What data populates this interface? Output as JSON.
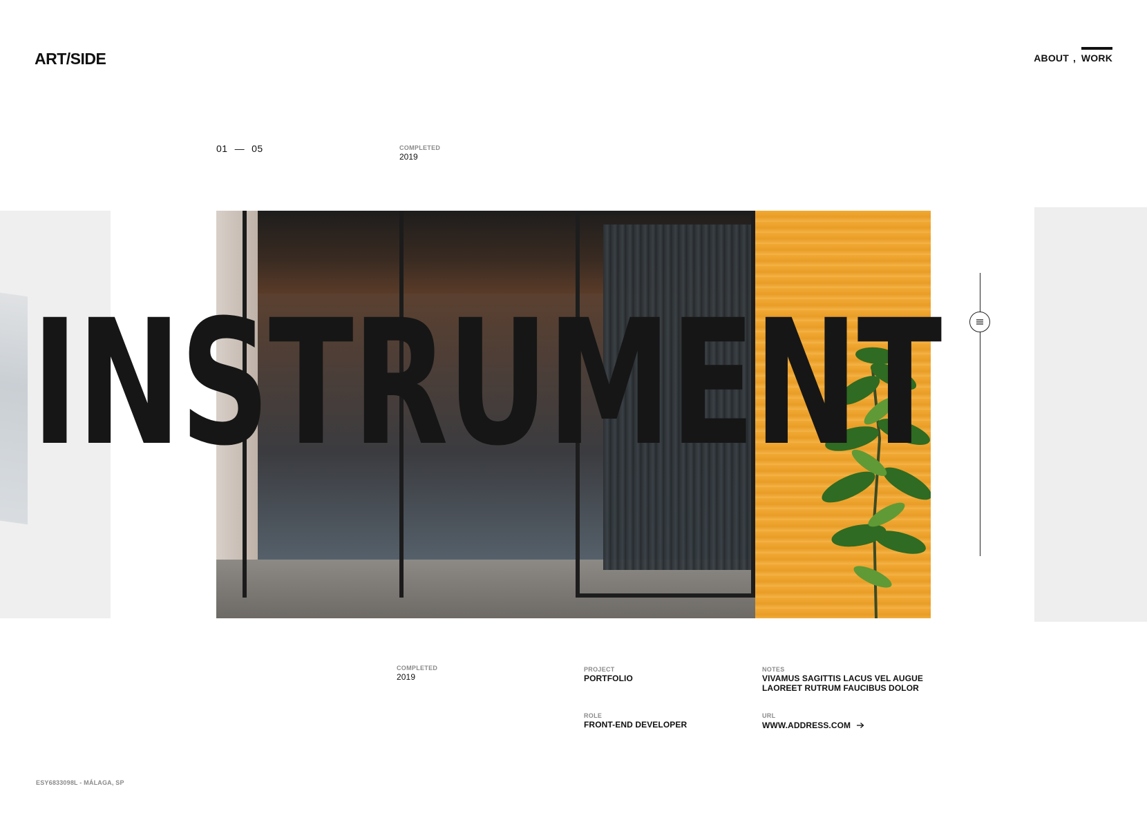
{
  "header": {
    "logo": "ART/SIDE",
    "nav": [
      {
        "label": "ABOUT"
      },
      {
        "label": "WORK",
        "active": true
      }
    ],
    "nav_separator": ","
  },
  "counter": {
    "current": "01",
    "dash": "—",
    "total": "05"
  },
  "top_meta": {
    "label": "COMPLETED",
    "value": "2019"
  },
  "project_title": "INSTRUMENT",
  "details": {
    "completed": {
      "label": "COMPLETED",
      "value": "2019"
    },
    "project": {
      "label": "PROJECT",
      "value": "PORTFOLIO"
    },
    "notes": {
      "label": "NOTES",
      "lines": [
        "VIVAMUS SAGITTIS LACUS VEL AUGUE",
        "LAOREET RUTRUM FAUCIBUS DOLOR"
      ]
    },
    "role": {
      "label": "ROLE",
      "value": "FRONT-END DEVELOPER"
    },
    "url": {
      "label": "URL",
      "value": "WWW.ADDRESS.COM"
    }
  },
  "footer": {
    "text": "ESY6833098L - MÁLAGA, SP"
  },
  "icons": {
    "scroll_handle": "menu-lines-icon",
    "url_arrow": "arrow-right-icon"
  },
  "colors": {
    "text": "#111111",
    "muted": "#8a8a8a",
    "panel": "#eeeeee",
    "wood": "#f2a935"
  }
}
